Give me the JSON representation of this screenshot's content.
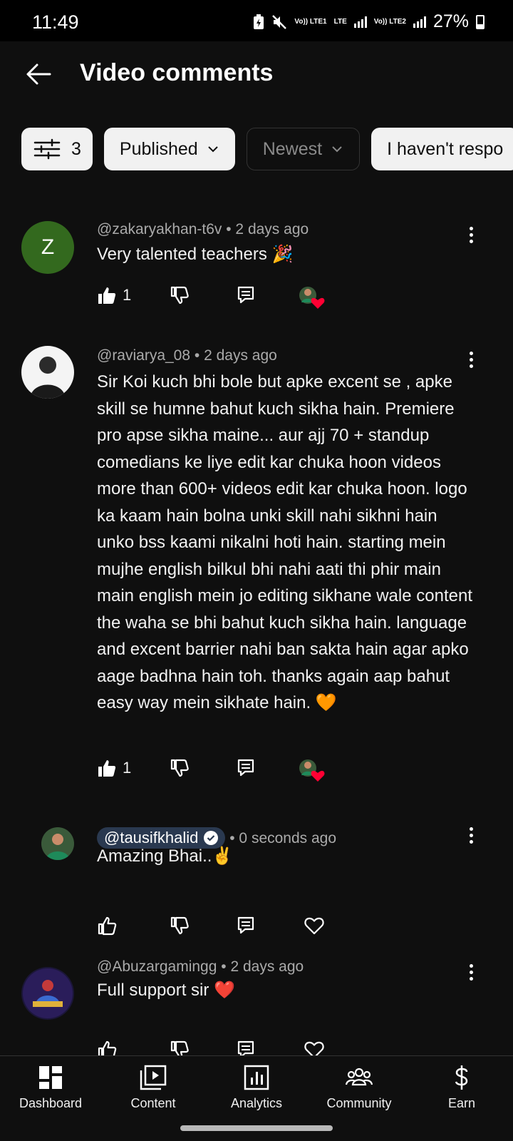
{
  "status_bar": {
    "time": "11:49",
    "network_1": "Vo)) LTE1",
    "network_lte": "LTE",
    "network_2": "Vo)) LTE2",
    "battery": "27%"
  },
  "header": {
    "title": "Video comments",
    "back_icon": "arrow-left-icon"
  },
  "filters": {
    "filter_count": "3",
    "published": "Published",
    "sort": "Newest",
    "responded": "I haven't respo"
  },
  "comments": [
    {
      "avatar_letter": "Z",
      "avatar_color": "#33691e",
      "author": "@zakaryakhan-t6v",
      "time": "• 2 days ago",
      "text": "Very talented teachers 🎉",
      "likes": "1"
    },
    {
      "author": "@raviarya_08",
      "time": "• 2 days ago",
      "text": "Sir Koi kuch bhi bole but apke excent se , apke skill se humne bahut kuch sikha hain. Premiere pro apse sikha maine... aur ajj 70 + standup comedians ke liye edit kar chuka hoon videos more than 600+ videos edit kar chuka hoon. logo ka kaam hain bolna unki skill nahi sikhni hain unko bss kaami nikalni hoti hain. starting mein mujhe english bilkul bhi nahi aati thi phir main main english mein jo editing sikhane wale content the waha se bhi bahut kuch sikha hain. language and excent barrier nahi ban sakta hain agar apko aage badhna hain toh. thanks  again aap bahut easy way mein sikhate hain. 🧡",
      "likes": "1"
    },
    {
      "author": "@tausifkhalid",
      "time": "• 0 seconds ago",
      "text": "Amazing Bhai..✌️"
    },
    {
      "author": "@Abuzargamingg",
      "time": "• 2 days ago",
      "text": "Full support sir ❤️"
    }
  ],
  "bottom_nav": [
    {
      "label": "Dashboard",
      "icon": "dashboard-icon"
    },
    {
      "label": "Content",
      "icon": "content-icon"
    },
    {
      "label": "Analytics",
      "icon": "analytics-icon"
    },
    {
      "label": "Community",
      "icon": "community-icon"
    },
    {
      "label": "Earn",
      "icon": "earn-icon"
    }
  ],
  "colors": {
    "background": "#0f0f0f",
    "chip_light": "#f1f1f1",
    "creator_pill": "#2a3950",
    "heart": "#ff0033"
  }
}
